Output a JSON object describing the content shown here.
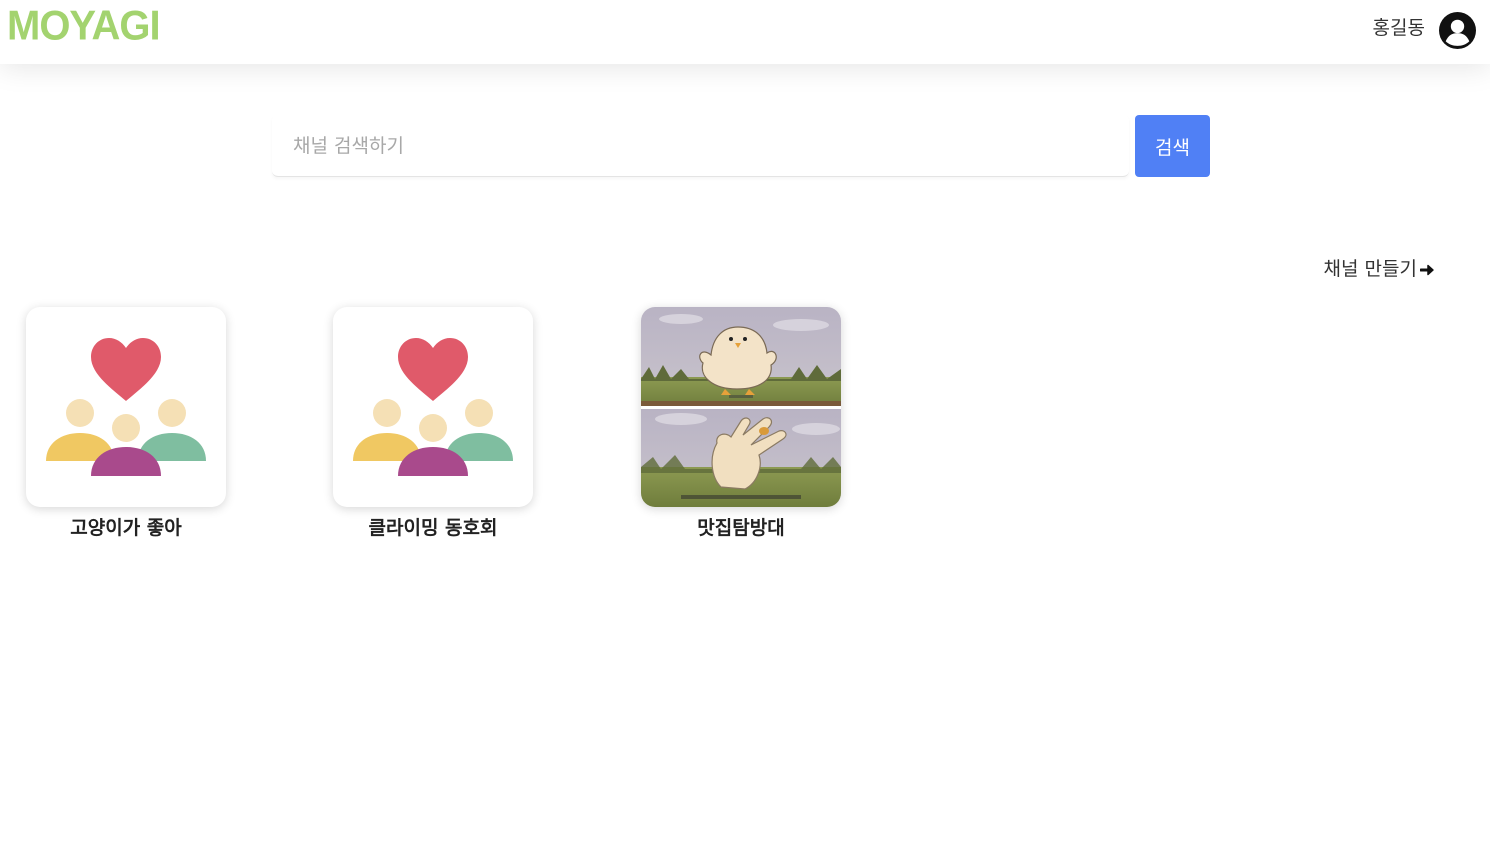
{
  "header": {
    "logo": "MOYAGI",
    "user_name": "홍길동"
  },
  "search": {
    "placeholder": "채널 검색하기",
    "value": "",
    "button_label": "검색"
  },
  "create_channel": {
    "label": "채널 만들기"
  },
  "channels": [
    {
      "name": "고양이가 좋아",
      "thumbnail": "group-heart-icon"
    },
    {
      "name": "클라이밍 동호회",
      "thumbnail": "group-heart-icon"
    },
    {
      "name": "맛집탐방대",
      "thumbnail": "cartoon-chick-image"
    }
  ],
  "colors": {
    "logo": "#a3d36f",
    "search_button": "#5080f5",
    "heart": "#e05a6a",
    "person_yellow": "#f0c862",
    "person_purple": "#a94a8c",
    "person_green": "#7fbea0",
    "head": "#f5e0b5"
  }
}
